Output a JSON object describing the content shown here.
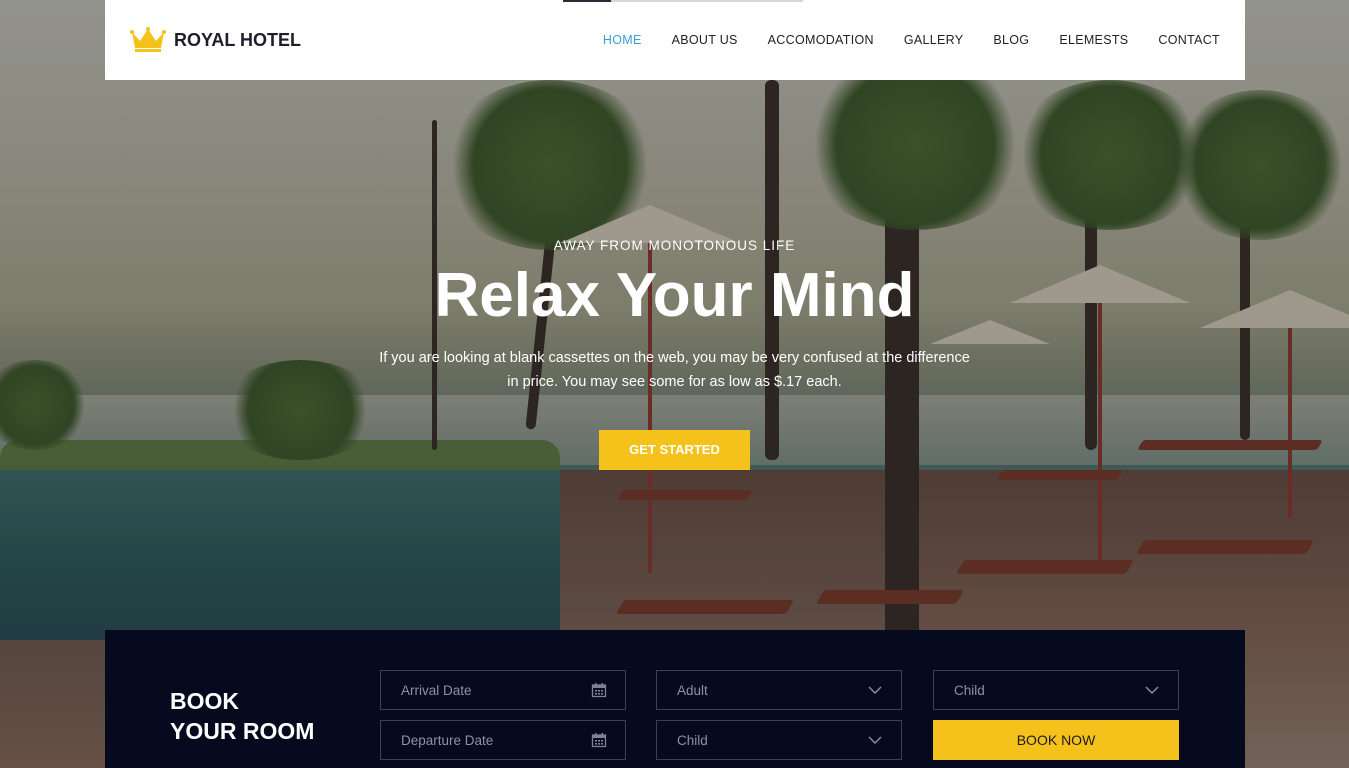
{
  "brand": {
    "name": "ROYAL HOTEL"
  },
  "nav": {
    "items": [
      {
        "label": "HOME",
        "active": true
      },
      {
        "label": "ABOUT US"
      },
      {
        "label": "ACCOMODATION"
      },
      {
        "label": "GALLERY"
      },
      {
        "label": "BLOG"
      },
      {
        "label": "ELEMESTS"
      },
      {
        "label": "CONTACT"
      }
    ]
  },
  "banner": {
    "kicker": "AWAY FROM MONOTONOUS LIFE",
    "title": "Relax Your Mind",
    "description": "If you are looking at blank cassettes on the web, you may be very confused at the difference in price. You may see some for as low as $.17 each.",
    "cta_label": "GET STARTED"
  },
  "booking": {
    "heading_line1": "BOOK",
    "heading_line2": "YOUR ROOM",
    "arrival_placeholder": "Arrival Date",
    "departure_placeholder": "Departure Date",
    "adult_select": "Adult",
    "child_select_1": "Child",
    "child_select_2": "Child",
    "book_label": "BOOK NOW"
  },
  "colors": {
    "accent": "#f5c11b",
    "active_nav": "#36a0dc",
    "panel_bg": "#050a1f"
  },
  "icons": {
    "logo": "crown-icon",
    "calendar": "calendar-icon",
    "dropdown": "chevron-down-icon"
  }
}
